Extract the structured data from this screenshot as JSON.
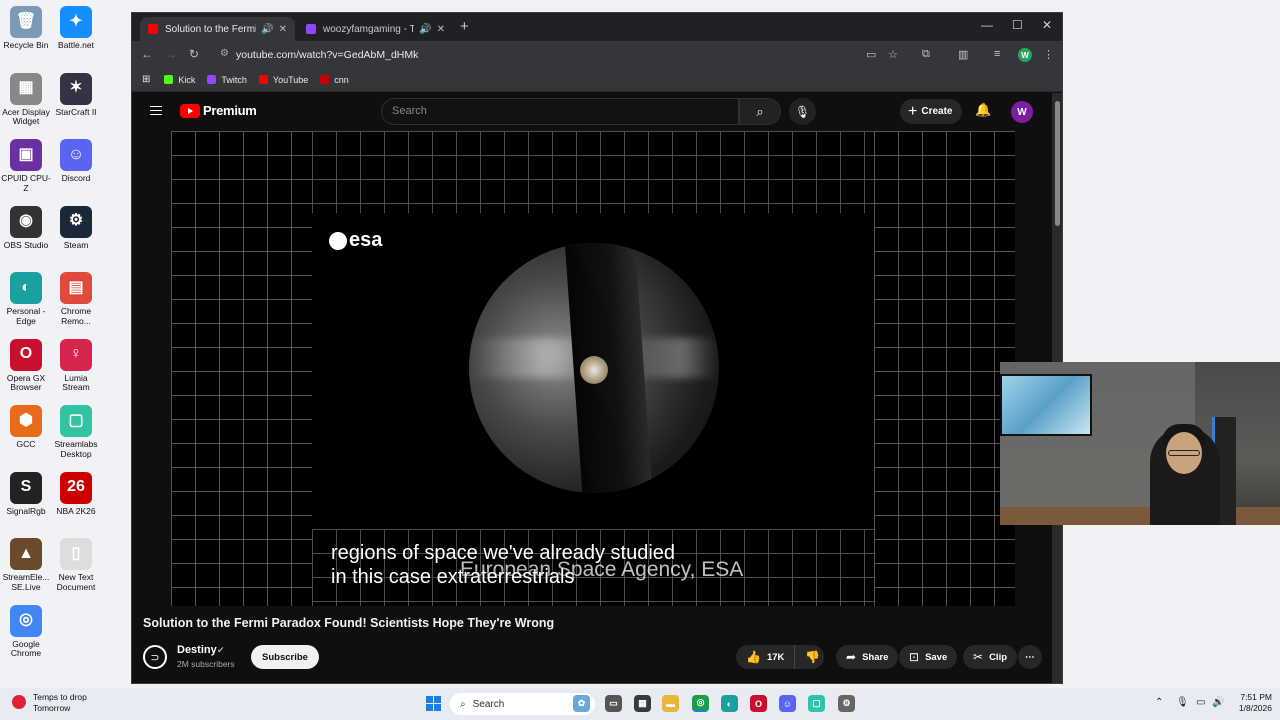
{
  "desktop": {
    "icons": [
      {
        "label": "Recycle Bin",
        "glyph": "🗑"
      },
      {
        "label": "Battle.net",
        "glyph": "✦"
      },
      {
        "label": "Acer Display Widget",
        "glyph": "▦"
      },
      {
        "label": "StarCraft II",
        "glyph": "✶"
      },
      {
        "label": "CPUID CPU-Z",
        "glyph": "▣"
      },
      {
        "label": "Discord",
        "glyph": "☺"
      },
      {
        "label": "OBS Studio",
        "glyph": "◉"
      },
      {
        "label": "Steam",
        "glyph": "⚙"
      },
      {
        "label": "Personal - Edge",
        "glyph": "◐"
      },
      {
        "label": "Chrome Remo...",
        "glyph": "▤"
      },
      {
        "label": "Opera GX Browser",
        "glyph": "O"
      },
      {
        "label": "Lumia Stream",
        "glyph": "♀"
      },
      {
        "label": "GCC",
        "glyph": "⬢"
      },
      {
        "label": "Streamlabs Desktop",
        "glyph": "▢"
      },
      {
        "label": "SignalRgb",
        "glyph": "S"
      },
      {
        "label": "NBA 2K26",
        "glyph": "26"
      },
      {
        "label": "StreamEle... SE.Live",
        "glyph": "▲"
      },
      {
        "label": "New Text Document",
        "glyph": "▯"
      },
      {
        "label": "Google Chrome",
        "glyph": "◎"
      }
    ]
  },
  "browser": {
    "tabs": [
      {
        "title": "Solution to the Fermi Parad",
        "active": true
      },
      {
        "title": "woozyfamgaming - Twitch",
        "active": false
      }
    ],
    "url": "youtube.com/watch?v=GedAbM_dHMk",
    "profile_initial": "W",
    "bookmarks": [
      {
        "label": "Kick",
        "color": "#53fc18"
      },
      {
        "label": "Twitch",
        "color": "#9146ff"
      },
      {
        "label": "YouTube",
        "color": "#ff0000"
      },
      {
        "label": "cnn",
        "color": "#cc0000"
      }
    ]
  },
  "youtube": {
    "logo_text": "Premium",
    "search_placeholder": "Search",
    "create_label": "Create",
    "avatar_initial": "W",
    "player": {
      "watermark": "esa",
      "caption_lines": [
        "regions of space we've already studied",
        "in this case extraterrestrials"
      ],
      "under_caption": "European Space Agency, ESA"
    },
    "video_title": "Solution to the Fermi Paradox Found! Scientists Hope They're Wrong",
    "channel": {
      "name": "Destiny",
      "subscribers": "2M subscribers",
      "subscribe_label": "Subscribe"
    },
    "actions": {
      "likes": "17K",
      "share": "Share",
      "save": "Save",
      "clip": "Clip"
    }
  },
  "taskbar": {
    "weather_line1": "Temps to drop",
    "weather_line2": "Tomorrow",
    "search_label": "Search",
    "time": "7:51 PM",
    "date": "1/8/2026"
  }
}
